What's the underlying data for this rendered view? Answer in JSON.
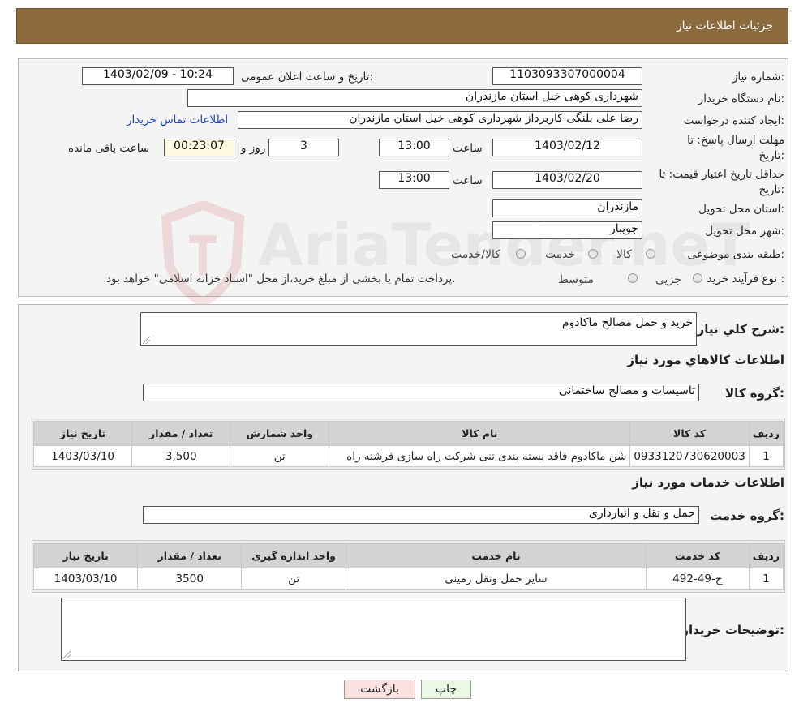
{
  "header": {
    "title": "جزئیات اطلاعات نیاز"
  },
  "form": {
    "need_number_label": "شماره نیاز:",
    "need_number": "1103093307000004",
    "announce_label": "تاریخ و ساعت اعلان عمومی:",
    "announce_value": "1403/02/09 - 10:24",
    "buyer_org_label": "نام دستگاه خریدار:",
    "buyer_org": "شهرداری کوهی خیل استان مازندران",
    "creator_label": "ایجاد کننده درخواست:",
    "creator": "رضا علی  بلنگی  کاربرداز شهرداری کوهی خیل استان مازندران",
    "contact_link": "اطلاعات تماس خریدار",
    "reply_deadline_label": "مهلت ارسال پاسخ: تا تاریخ:",
    "reply_date": "1403/02/12",
    "time_label": "ساعت",
    "reply_time": "13:00",
    "days": "3",
    "days_label": "روز و",
    "remaining": "00:23:07",
    "remaining_label": "ساعت باقی مانده",
    "validity_label": "حداقل تاریخ اعتبار قیمت: تا تاریخ:",
    "validity_date": "1403/02/20",
    "validity_time": "13:00",
    "province_label": "استان محل تحویل:",
    "province": "مازندران",
    "city_label": "شهر محل تحویل:",
    "city": "جویبار",
    "category_label": "طبقه بندی موضوعی:",
    "category_options": [
      "کالا",
      "خدمت",
      "کالا/خدمت"
    ],
    "process_label": "نوع فرآیند خرید :",
    "process_options": [
      "جزیی",
      "متوسط"
    ],
    "process_note": "پرداخت تمام یا بخشی از مبلغ خرید،از محل \"اسناد خزانه اسلامی\" خواهد بود."
  },
  "details": {
    "summary_label": "شرح کلي نياز:",
    "summary": "خرید و حمل مصالح ماکادوم",
    "goods_title": "اطلاعات کالاهاي مورد نياز",
    "goods_group_label": "گروه کالا:",
    "goods_group": "تاسیسات و مصالح ساختمانی",
    "goods_headers": [
      "ردیف",
      "کد کالا",
      "نام کالا",
      "واحد شمارش",
      "تعداد / مقدار",
      "تاریخ نیاز"
    ],
    "goods_rows": [
      [
        "1",
        "0933120730620003",
        "شن ماکادوم فاقد بسته بندی تنی شرکت راه سازی فرشته راه",
        "تن",
        "3,500",
        "1403/03/10"
      ]
    ],
    "services_title": "اطلاعات خدمات مورد نياز",
    "service_group_label": "گروه خدمت:",
    "service_group": "حمل و نقل و انبارداری",
    "services_headers": [
      "ردیف",
      "کد خدمت",
      "نام خدمت",
      "واحد اندازه گیری",
      "تعداد / مقدار",
      "تاریخ نیاز"
    ],
    "services_rows": [
      [
        "1",
        "ح-49-492",
        "سایر حمل ونقل زمینی",
        "تن",
        "3500",
        "1403/03/10"
      ]
    ],
    "buyer_notes_label": "توضیحات خریدار:",
    "buyer_notes": ""
  },
  "buttons": {
    "print": "چاپ",
    "back": "بازگشت"
  },
  "watermark": "AriaTender.neT",
  "colors": {
    "header_bg": "#8b6a3e",
    "print_btn": "#eaf8e6",
    "back_btn": "#fde2e2",
    "link": "#1a3fd0"
  }
}
